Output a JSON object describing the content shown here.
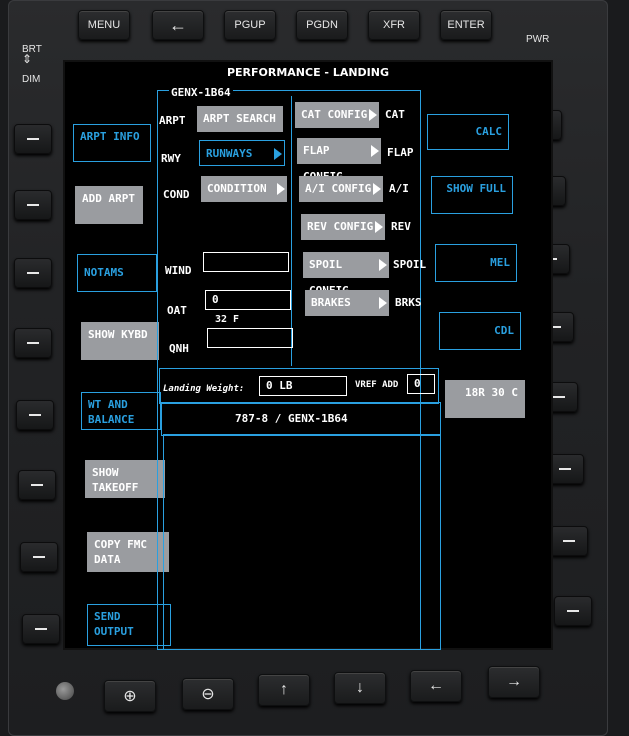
{
  "top_keys": [
    "MENU",
    "←",
    "PGUP",
    "PGDN",
    "XFR",
    "ENTER"
  ],
  "bezel": {
    "brt": "BRT",
    "dim": "DIM",
    "pwr": "PWR"
  },
  "screen": {
    "title": "PERFORMANCE - LANDING",
    "engine": "GENX-1B64",
    "left_buttons": [
      "ARPT INFO",
      "ADD ARPT",
      "NOTAMS",
      "SHOW KYBD",
      "WT AND BALANCE",
      "SHOW TAKEOFF",
      "COPY FMC DATA",
      "SEND OUTPUT"
    ],
    "right_buttons": [
      "CALC",
      "SHOW FULL",
      "MEL",
      "CDL",
      "18R 30 C"
    ],
    "rows": {
      "arpt": {
        "label": "ARPT",
        "button": "ARPT SEARCH"
      },
      "rwy": {
        "label": "RWY",
        "button": "RUNWAYS"
      },
      "cond": {
        "label": "COND",
        "button": "CONDITION"
      },
      "wind": {
        "label": "WIND",
        "value": ""
      },
      "oat": {
        "label": "OAT",
        "value": "0",
        "sub": "32 F"
      },
      "qnh": {
        "label": "QNH",
        "value": ""
      }
    },
    "configs": [
      {
        "button": "CAT CONFIG",
        "value": "CAT"
      },
      {
        "button": "FLAP CONFIG",
        "value": "FLAP"
      },
      {
        "button": "A/I CONFIG",
        "value": "A/I"
      },
      {
        "button": "REV CONFIG",
        "value": "REV"
      },
      {
        "button": "SPOIL CONFIG",
        "value": "SPOIL"
      },
      {
        "button": "BRAKES",
        "value": "BRKS"
      }
    ],
    "landing_weight_label": "Landing Weight:",
    "landing_weight_value": "0 LB",
    "vref_label": "VREF ADD",
    "vref_value": "0",
    "aircraft": "787-8 / GENX-1B64"
  },
  "bottom_keys": [
    "⊕",
    "⊖",
    "↑",
    "↓",
    "←",
    "→"
  ],
  "colors": {
    "accent": "#2aa0e0",
    "gray_button": "#9a9ca0"
  }
}
